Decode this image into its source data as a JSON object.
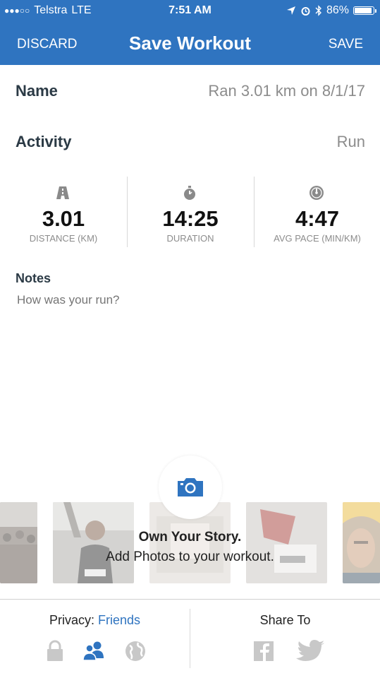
{
  "status_bar": {
    "signal_dots": "●●●○○",
    "carrier": "Telstra",
    "network": "LTE",
    "time": "7:51 AM",
    "battery": "86%",
    "battery_level": 0.86
  },
  "nav": {
    "discard_label": "DISCARD",
    "title": "Save Workout",
    "save_label": "SAVE"
  },
  "form": {
    "name_label": "Name",
    "name_value": "Ran 3.01 km on 8/1/17",
    "activity_label": "Activity",
    "activity_value": "Run"
  },
  "stats": [
    {
      "value": "3.01",
      "caption": "DISTANCE (KM)",
      "icon": "road-icon"
    },
    {
      "value": "14:25",
      "caption": "DURATION",
      "icon": "stopwatch-icon"
    },
    {
      "value": "4:47",
      "caption": "AVG PACE (MIN/KM)",
      "icon": "speedometer-icon"
    }
  ],
  "notes": {
    "label": "Notes",
    "placeholder": "How was your run?"
  },
  "photos": {
    "title": "Own Your Story.",
    "subtitle": "Add Photos to your workout.",
    "thumbnails": [
      "crowd-photo",
      "runner-photo",
      "gift-photo",
      "race-bib-photo",
      "portrait-photo"
    ]
  },
  "footer": {
    "privacy_label": "Privacy:",
    "privacy_value": "Friends",
    "share_label": "Share To"
  },
  "colors": {
    "brand": "#2f74c0",
    "label": "#2b3a45",
    "muted": "#8c8c8c",
    "icon_gray": "#c8c8c8"
  }
}
